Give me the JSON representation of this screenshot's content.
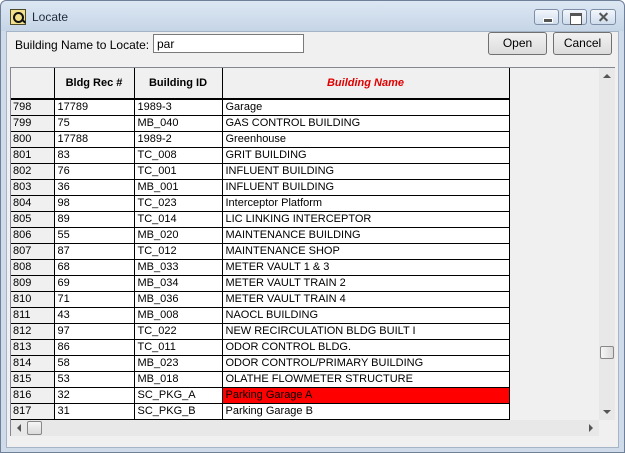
{
  "window": {
    "title": "Locate"
  },
  "search": {
    "label": "Building Name to Locate:",
    "value": "par"
  },
  "buttons": {
    "open": "Open",
    "cancel": "Cancel"
  },
  "grid": {
    "headers": [
      "",
      "Bldg Rec #",
      "Building ID",
      "Building Name"
    ],
    "selected_row_index": 18,
    "selected_color": "#ff0000",
    "rows": [
      {
        "row": "798",
        "rec": "17789",
        "id": "1989-3",
        "name": "Garage"
      },
      {
        "row": "799",
        "rec": "75",
        "id": "MB_040",
        "name": "GAS CONTROL BUILDING"
      },
      {
        "row": "800",
        "rec": "17788",
        "id": "1989-2",
        "name": "Greenhouse"
      },
      {
        "row": "801",
        "rec": "83",
        "id": "TC_008",
        "name": "GRIT BUILDING"
      },
      {
        "row": "802",
        "rec": "76",
        "id": "TC_001",
        "name": "INFLUENT BUILDING"
      },
      {
        "row": "803",
        "rec": "36",
        "id": "MB_001",
        "name": "INFLUENT BUILDING"
      },
      {
        "row": "804",
        "rec": "98",
        "id": "TC_023",
        "name": "Interceptor Platform"
      },
      {
        "row": "805",
        "rec": "89",
        "id": "TC_014",
        "name": "LIC LINKING INTERCEPTOR"
      },
      {
        "row": "806",
        "rec": "55",
        "id": "MB_020",
        "name": "MAINTENANCE BUILDING"
      },
      {
        "row": "807",
        "rec": "87",
        "id": "TC_012",
        "name": "MAINTENANCE SHOP"
      },
      {
        "row": "808",
        "rec": "68",
        "id": "MB_033",
        "name": "METER VAULT 1 & 3"
      },
      {
        "row": "809",
        "rec": "69",
        "id": "MB_034",
        "name": "METER VAULT TRAIN 2"
      },
      {
        "row": "810",
        "rec": "71",
        "id": "MB_036",
        "name": "METER VAULT TRAIN 4"
      },
      {
        "row": "811",
        "rec": "43",
        "id": "MB_008",
        "name": "NAOCL BUILDING"
      },
      {
        "row": "812",
        "rec": "97",
        "id": "TC_022",
        "name": "NEW RECIRCULATION BLDG BUILT I"
      },
      {
        "row": "813",
        "rec": "86",
        "id": "TC_011",
        "name": "ODOR CONTROL BLDG."
      },
      {
        "row": "814",
        "rec": "58",
        "id": "MB_023",
        "name": "ODOR CONTROL/PRIMARY BUILDING"
      },
      {
        "row": "815",
        "rec": "53",
        "id": "MB_018",
        "name": "OLATHE FLOWMETER STRUCTURE"
      },
      {
        "row": "816",
        "rec": "32",
        "id": "SC_PKG_A",
        "name": "Parking Garage A"
      },
      {
        "row": "817",
        "rec": "31",
        "id": "SC_PKG_B",
        "name": "Parking Garage B"
      }
    ]
  },
  "icons": {
    "app": "locate-app-icon",
    "minimize": "minimize-icon",
    "maximize": "maximize-icon",
    "close": "close-icon"
  }
}
